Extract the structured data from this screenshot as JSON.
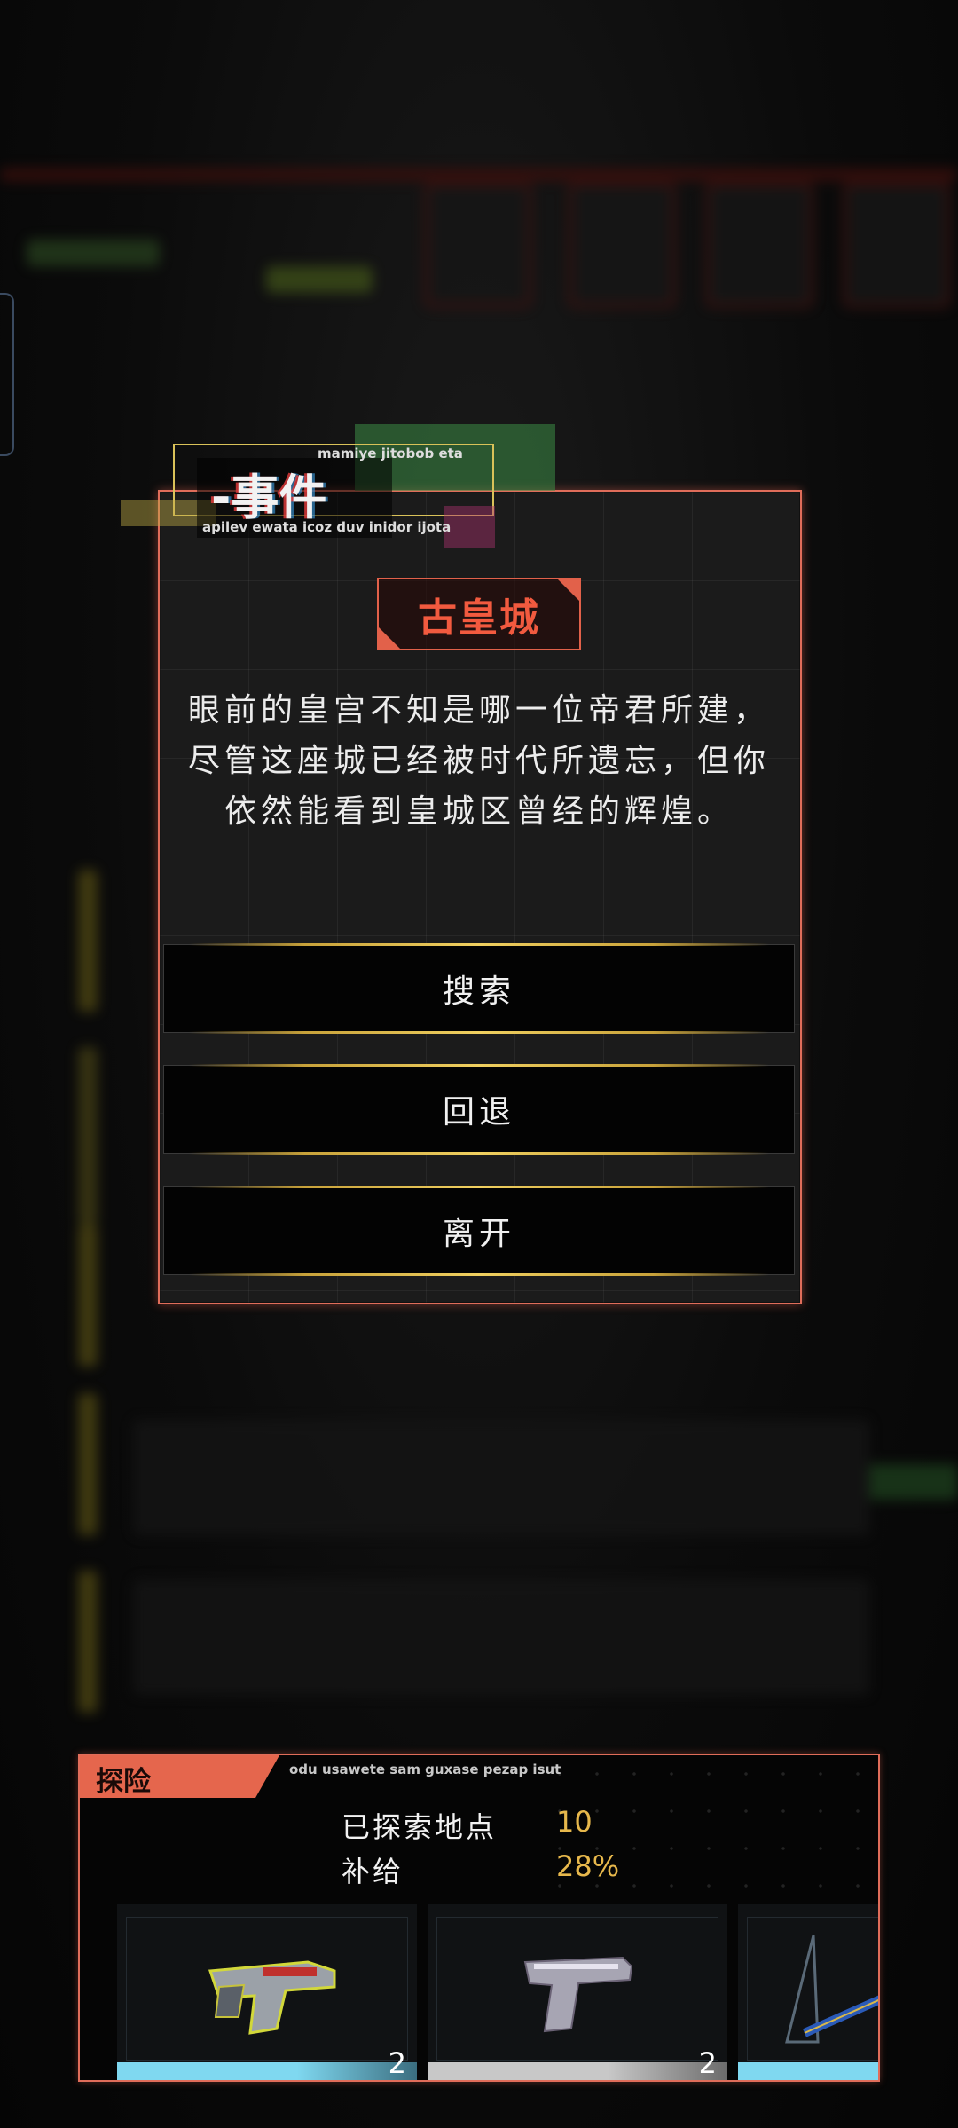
{
  "event": {
    "header_title": "-事件",
    "header_sub_top": "mamiye jitobob eta",
    "header_sub_bottom": "apilev ewata icoz duv inidor ijota",
    "location_title": "古皇城",
    "description": "眼前的皇宫不知是哪一位帝君所建，尽管这座城已经被时代所遗忘，但你依然能看到皇城区曾经的辉煌。",
    "options": [
      "搜索",
      "回退",
      "离开"
    ]
  },
  "explore": {
    "tab_label": "探险",
    "subtitle": "odu usawete sam guxase pezap isut",
    "explored_label": "已探索地点",
    "explored_value": "10",
    "supply_label": "补给",
    "supply_value": "28%",
    "items": [
      {
        "icon": "smg-weapon-icon",
        "count": "2",
        "rarity_color": "#7fd8f0"
      },
      {
        "icon": "pistol-weapon-icon",
        "count": "2",
        "rarity_color": "#c8c8c8"
      },
      {
        "icon": "blade-weapon-icon",
        "count": "",
        "rarity_color": "#7fd8f0"
      }
    ]
  },
  "colors": {
    "accent": "#e06d5a",
    "gold": "#e7b84c",
    "header_border": "#d9c259"
  }
}
